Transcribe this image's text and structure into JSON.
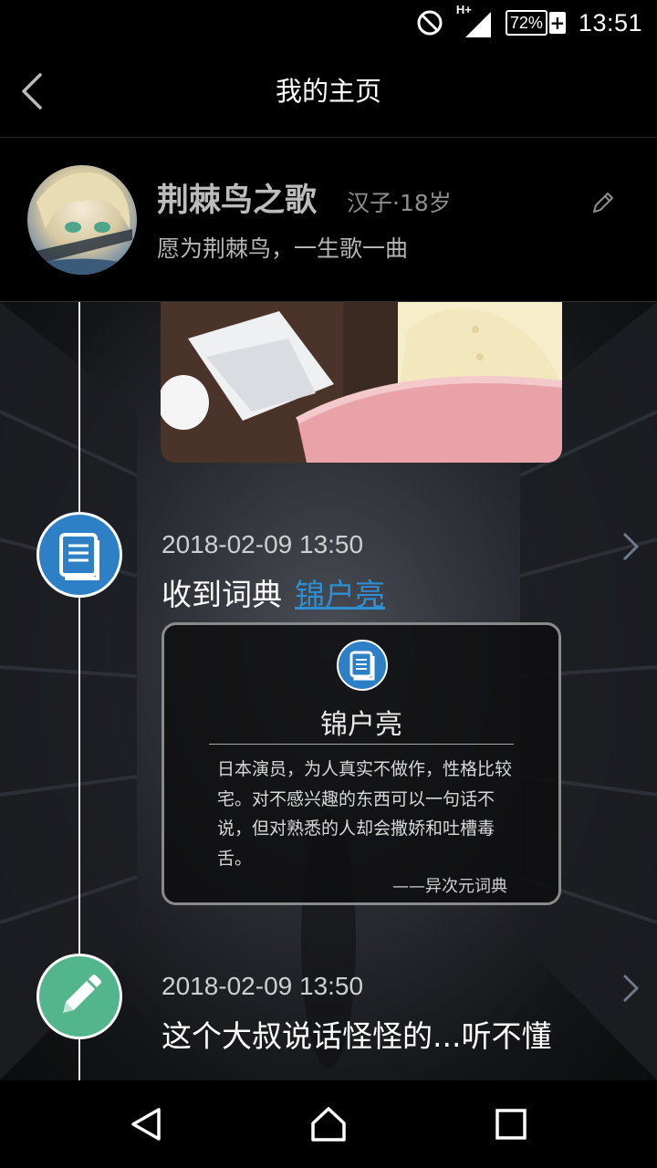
{
  "status_bar": {
    "time": "13:51",
    "battery": "72%",
    "network": "H+",
    "icons": [
      "do-not-disturb-icon",
      "signal-icon",
      "battery-icon",
      "charging-icon"
    ]
  },
  "header": {
    "title": "我的主页",
    "back_icon": "back-arrow-icon"
  },
  "profile": {
    "name": "荆棘鸟之歌",
    "meta": "汉子·18岁",
    "bio": "愿为荆棘鸟，一生歌一曲",
    "edit_icon": "pencil-icon"
  },
  "timeline": [
    {
      "icon": "book-icon",
      "icon_color": "#2d80c5",
      "timestamp": "2018-02-09 13:50",
      "action": "收到词典",
      "link": "锦户亮",
      "card": {
        "term": "锦户亮",
        "definition": "日本演员，为人真实不做作，性格比较宅。对不感兴趣的东西可以一句话不说，但对熟悉的人却会撒娇和吐槽毒舌。",
        "source": "——异次元词典"
      }
    },
    {
      "icon": "pencil-icon",
      "icon_color": "#52b58c",
      "timestamp": "2018-02-09 13:50",
      "action": "这个大叔说话怪怪的...听不懂"
    }
  ],
  "nav_bar": {
    "icons": [
      "back-triangle-icon",
      "home-icon",
      "recents-icon"
    ]
  }
}
